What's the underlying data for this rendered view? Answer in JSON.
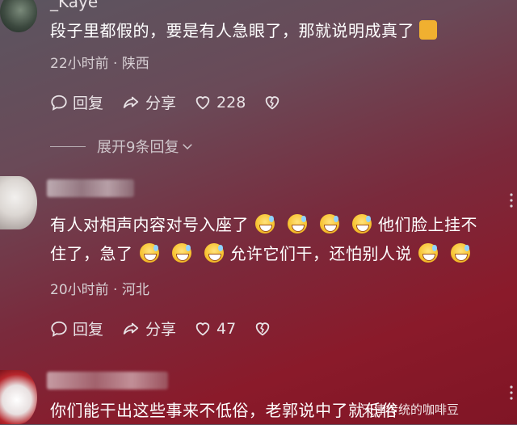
{
  "comments": [
    {
      "username": "_Kaye",
      "text": "段子里都假的，要是有人急眼了，那就说明成真了",
      "meta": "22小时前 · 陕西",
      "reply_label": "回复",
      "share_label": "分享",
      "likes": "228",
      "expand_label": "展开9条回复"
    },
    {
      "text_part1": "有人对相声内容对号入座了",
      "text_part2": "他们脸上挂不",
      "text_part3": "住了，急了",
      "text_part4": "允许它们干，还怕别人说",
      "meta": "20小时前 · 河北",
      "reply_label": "回复",
      "share_label": "分享",
      "likes": "47"
    },
    {
      "text": "你们能干出这些事来不低俗，老郭说中了就低俗"
    }
  ],
  "watermark": "天津传统的咖啡豆",
  "icons": {
    "reply": "comment-bubble-icon",
    "share": "share-arrow-icon",
    "like": "heart-icon",
    "dislike": "broken-heart-icon",
    "expand": "chevron-down-icon",
    "more": "more-vertical-icon"
  }
}
